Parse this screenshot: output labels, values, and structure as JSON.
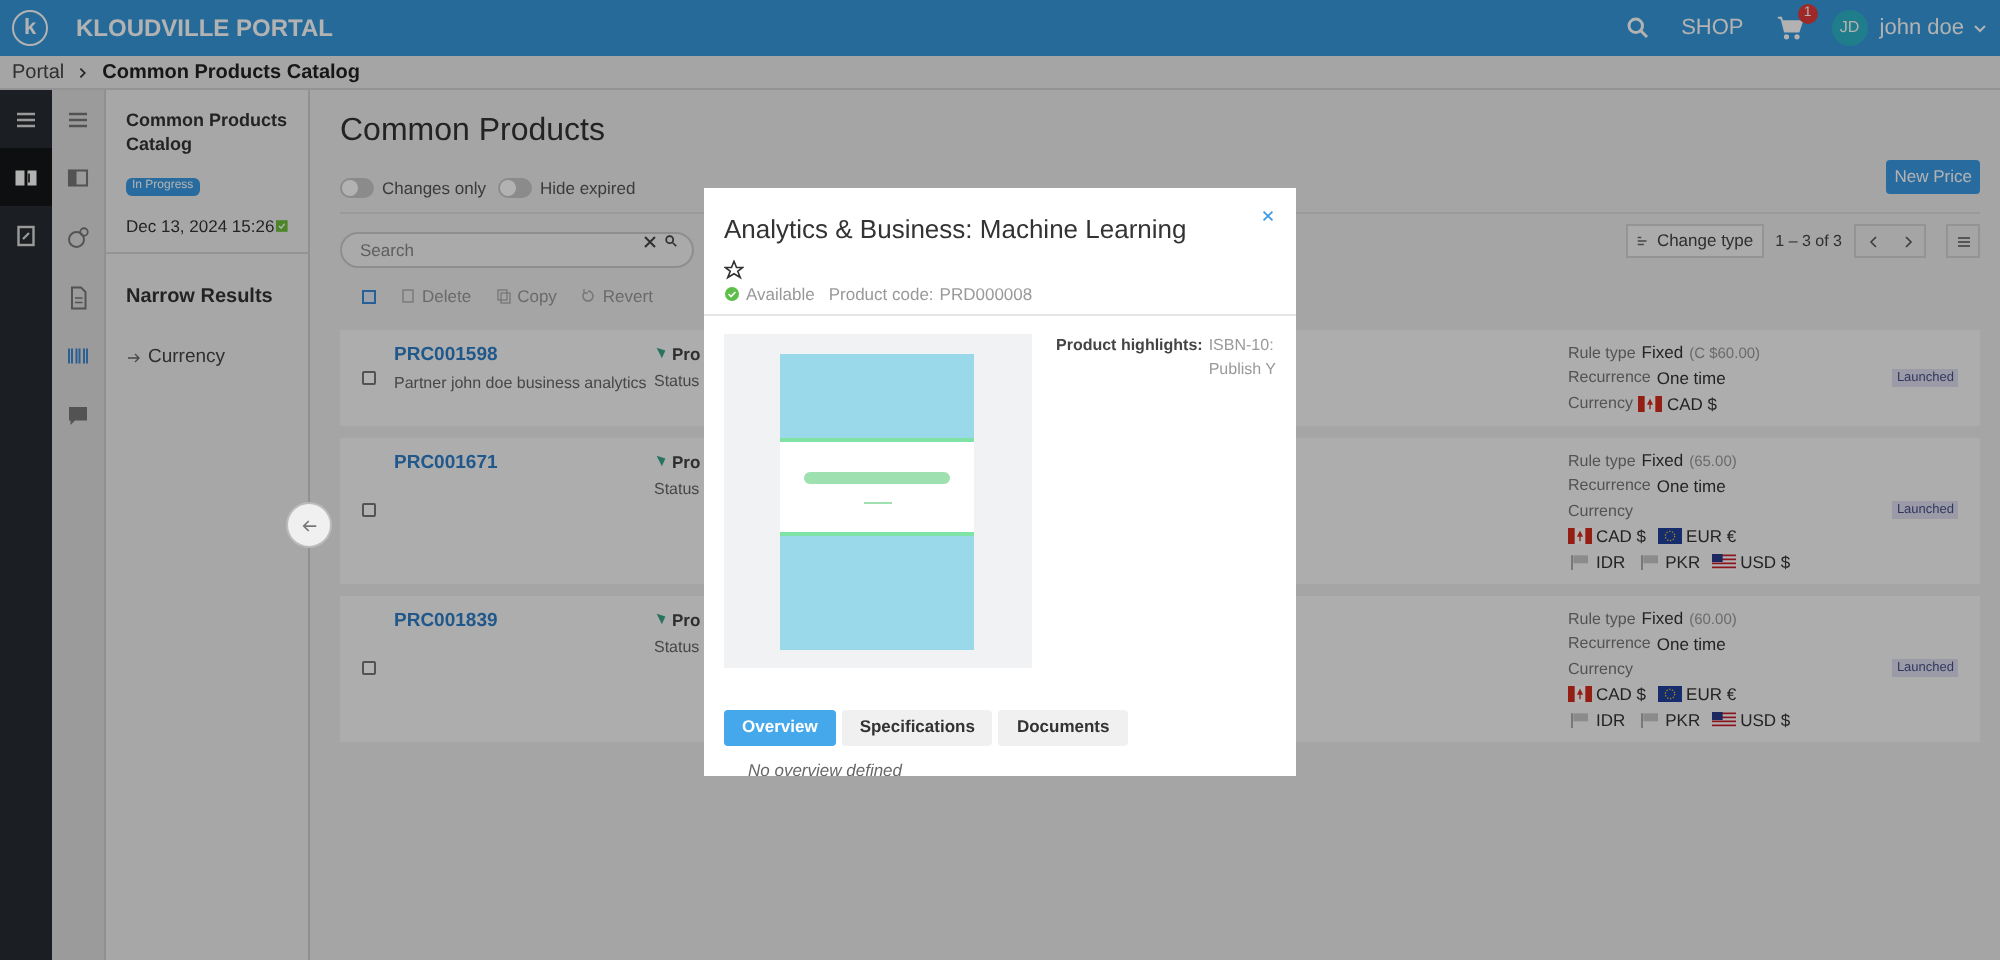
{
  "header": {
    "logo_letter": "k",
    "title": "KLOUDVILLE PORTAL",
    "shop": "SHOP",
    "cart_count": "1",
    "avatar": "JD",
    "user": "john doe"
  },
  "breadcrumb": [
    "Portal",
    "Common Products Catalog"
  ],
  "rail": [
    {
      "selected": false
    },
    {
      "selected": true
    },
    {
      "selected": false
    }
  ],
  "subrail": [
    {
      "selected": false
    },
    {
      "selected": false
    },
    {
      "selected": false
    },
    {
      "selected": false
    },
    {
      "selected": true
    },
    {
      "selected": false
    }
  ],
  "catalog": {
    "title": "Common Products Catalog",
    "badge": "In Progress",
    "date": "Dec 13, 2024 15:26",
    "narrow_title": "Narrow Results",
    "filters": [
      "Currency"
    ]
  },
  "main": {
    "title": "Common Products",
    "toggles": [
      {
        "label": "Changes only",
        "on": false
      },
      {
        "label": "Hide expired",
        "on": false
      }
    ],
    "new_button": "New Price",
    "search": {
      "placeholder": "Search"
    },
    "select_all_checked": false,
    "change_type": "Change type",
    "paging": "1 – 3 of 3",
    "actions": [
      "Delete",
      "Copy",
      "Revert"
    ]
  },
  "rows": [
    {
      "code": "PRC001598",
      "description": "Partner john doe business analytics",
      "col3": "Pro",
      "status": "Status",
      "rule_label": "Rule type",
      "rule": "Fixed",
      "amount": "(C $60.00)",
      "recurrence_label": "Recurrence",
      "recurrence": "One time",
      "currency_label": "Currency",
      "currencies": [
        {
          "kind": "ca",
          "code": "CAD $"
        }
      ],
      "badge": "Launched",
      "checked": false
    },
    {
      "code": "PRC001671",
      "col3": "Pro",
      "status": "Status",
      "rule_label": "Rule type",
      "rule": "Fixed",
      "amount": "(65.00)",
      "recurrence_label": "Recurrence",
      "recurrence": "One time",
      "currency_label": "Currency",
      "currencies": [
        {
          "kind": "ca",
          "code": "CAD $"
        },
        {
          "kind": "eu",
          "code": "EUR €"
        },
        {
          "kind": "generic",
          "code": "IDR"
        },
        {
          "kind": "generic",
          "code": "PKR"
        },
        {
          "kind": "us",
          "code": "USD $"
        }
      ],
      "badge": "Launched",
      "checked": false
    },
    {
      "code": "PRC001839",
      "col3": "Pro",
      "status": "Status",
      "rule_label": "Rule type",
      "rule": "Fixed",
      "amount": "(60.00)",
      "recurrence_label": "Recurrence",
      "recurrence": "One time",
      "currency_label": "Currency",
      "currencies": [
        {
          "kind": "ca",
          "code": "CAD $"
        },
        {
          "kind": "eu",
          "code": "EUR €"
        },
        {
          "kind": "generic",
          "code": "IDR"
        },
        {
          "kind": "generic",
          "code": "PKR"
        },
        {
          "kind": "us",
          "code": "USD $"
        }
      ],
      "badge": "Launched",
      "checked": false
    }
  ],
  "modal": {
    "title": "Analytics & Business: Machine Learning",
    "starred": false,
    "availability": "Available",
    "code_label": "Product code:",
    "code": "PRD000008",
    "highlights_label": "Product highlights:",
    "highlights": [
      "ISBN-10:",
      "Publish Y"
    ],
    "tabs": [
      {
        "label": "Overview",
        "selected": true
      },
      {
        "label": "Specifications",
        "selected": false
      },
      {
        "label": "Documents",
        "selected": false
      }
    ],
    "overview": "No overview defined"
  }
}
